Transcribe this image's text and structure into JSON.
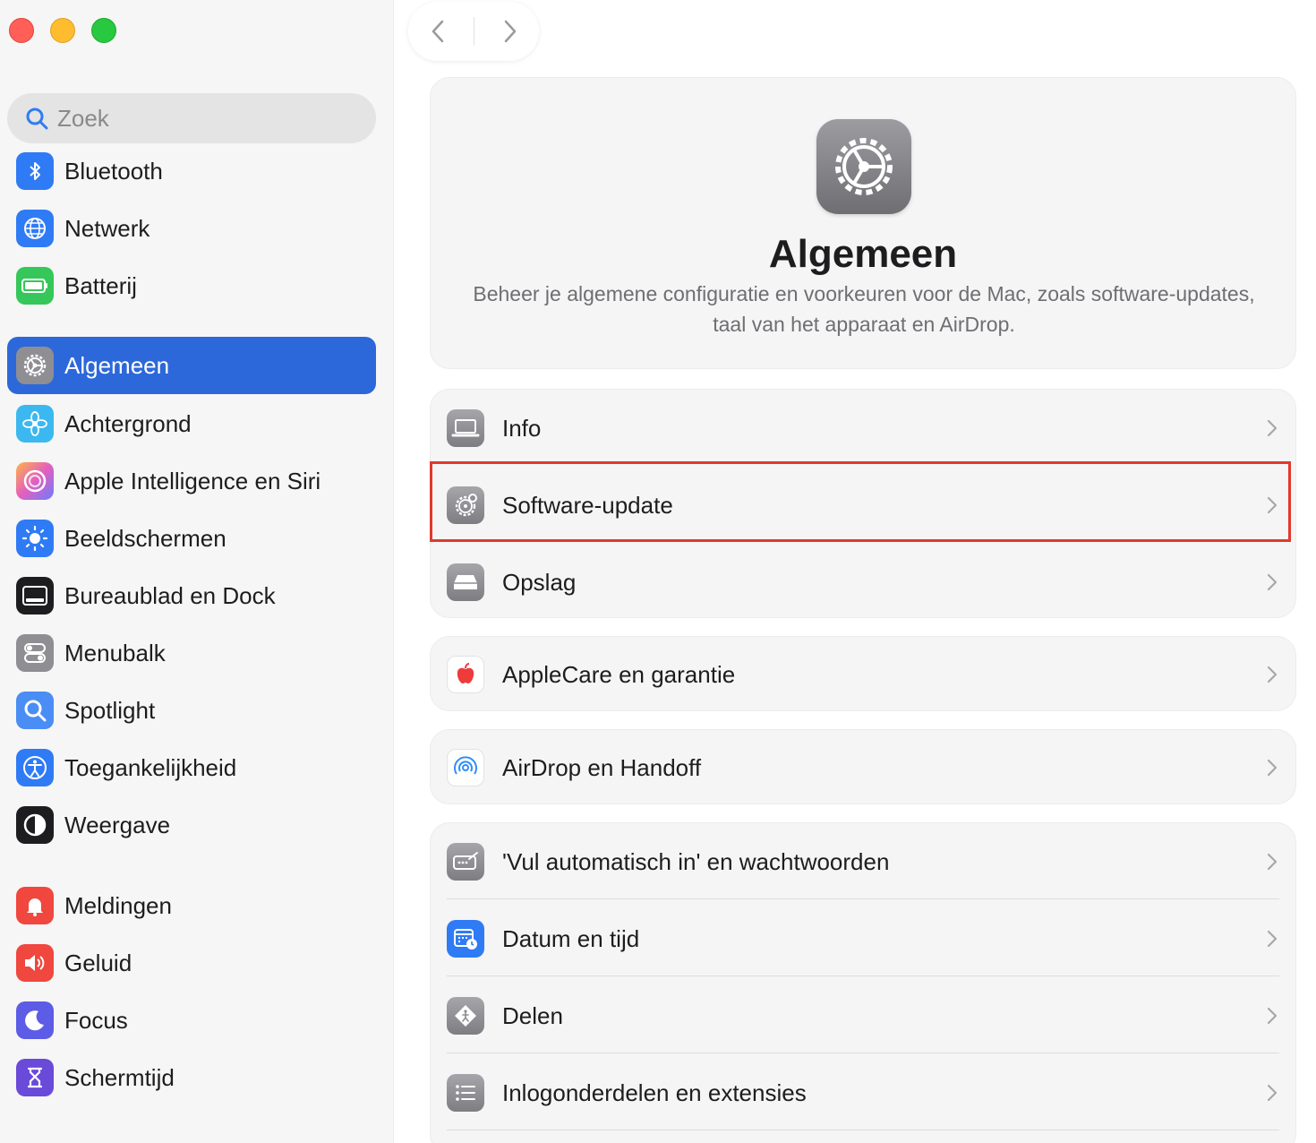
{
  "window": {
    "traffic_lights": [
      "close",
      "minimize",
      "zoom"
    ]
  },
  "sidebar": {
    "search_placeholder": "Zoek",
    "items": [
      {
        "label": "Bluetooth",
        "icon": "bluetooth-icon",
        "color": "#2f7bf5"
      },
      {
        "label": "Netwerk",
        "icon": "globe-icon",
        "color": "#2f7bf5"
      },
      {
        "label": "Batterij",
        "icon": "battery-icon",
        "color": "#35c759"
      },
      {
        "label": "Algemeen",
        "icon": "gear-icon",
        "color": "#8e8e93",
        "selected": true
      },
      {
        "label": "Achtergrond",
        "icon": "flower-icon",
        "color": "#3cb8f0"
      },
      {
        "label": "Apple Intelligence en Siri",
        "icon": "siri-icon",
        "color": "#d96bd9"
      },
      {
        "label": "Beeldschermen",
        "icon": "sun-icon",
        "color": "#2f7bf5"
      },
      {
        "label": "Bureaublad en Dock",
        "icon": "dock-icon",
        "color": "#1d1d1f"
      },
      {
        "label": "Menubalk",
        "icon": "toggles-icon",
        "color": "#8e8e93"
      },
      {
        "label": "Spotlight",
        "icon": "magnifier-icon",
        "color": "#4a8df5"
      },
      {
        "label": "Toegankelijkheid",
        "icon": "accessibility-icon",
        "color": "#2f7bf5"
      },
      {
        "label": "Weergave",
        "icon": "appearance-icon",
        "color": "#1d1d1f"
      },
      {
        "label": "Meldingen",
        "icon": "bell-icon",
        "color": "#f0473e"
      },
      {
        "label": "Geluid",
        "icon": "speaker-icon",
        "color": "#f0473e"
      },
      {
        "label": "Focus",
        "icon": "moon-icon",
        "color": "#5d5ce6"
      },
      {
        "label": "Schermtijd",
        "icon": "hourglass-icon",
        "color": "#6a4ad9"
      }
    ]
  },
  "nav": {
    "back_icon": "chevron-left-icon",
    "forward_icon": "chevron-right-icon"
  },
  "hero": {
    "title": "Algemeen",
    "description": "Beheer je algemene configuratie en voorkeuren voor de Mac, zoals software-updates, taal van het apparaat en AirDrop.",
    "icon": "gear-icon"
  },
  "groups": [
    {
      "rows": [
        {
          "label": "Info",
          "icon": "laptop-icon"
        },
        {
          "label": "Software-update",
          "icon": "gear-badge-icon",
          "highlighted": true
        },
        {
          "label": "Opslag",
          "icon": "disk-icon"
        }
      ]
    },
    {
      "rows": [
        {
          "label": "AppleCare en garantie",
          "icon": "apple-icon"
        }
      ]
    },
    {
      "rows": [
        {
          "label": "AirDrop en Handoff",
          "icon": "airdrop-icon"
        }
      ]
    },
    {
      "rows": [
        {
          "label": "'Vul automatisch in' en wachtwoorden",
          "icon": "keyboard-icon"
        },
        {
          "label": "Datum en tijd",
          "icon": "calendar-clock-icon"
        },
        {
          "label": "Delen",
          "icon": "sharing-icon"
        },
        {
          "label": "Inlogonderdelen en extensies",
          "icon": "list-icon"
        }
      ]
    }
  ],
  "colors": {
    "accent": "#2c68d9",
    "highlight_border": "#e0392b"
  }
}
